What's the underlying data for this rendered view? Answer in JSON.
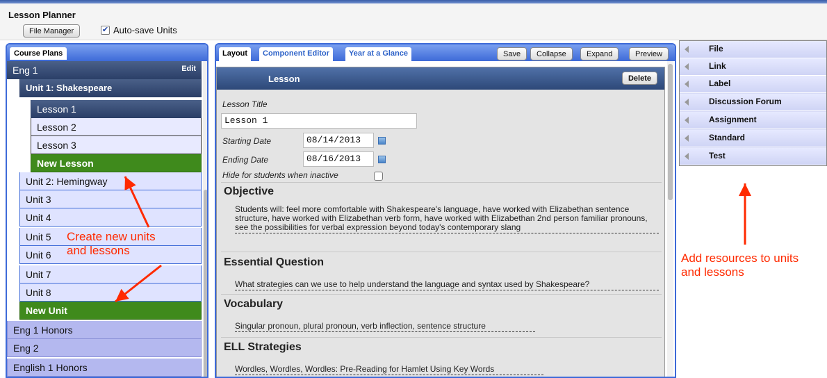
{
  "app": {
    "title": "Lesson Planner"
  },
  "toolbar": {
    "file_manager": "File Manager",
    "autosave_label": "Auto-save Units",
    "autosave_checked": true
  },
  "left_panel": {
    "tab": "Course Plans",
    "course": "Eng 1",
    "edit_label": "Edit",
    "unit1": "Unit 1: Shakespeare",
    "lessons": [
      "Lesson 1",
      "Lesson 2",
      "Lesson 3"
    ],
    "new_lesson": "New Lesson",
    "units": [
      "Unit 2: Hemingway",
      "Unit 3",
      "Unit 4",
      "Unit 5",
      "Unit 6",
      "Unit 7",
      "Unit 8"
    ],
    "new_unit": "New Unit",
    "other_courses": [
      "Eng 1 Honors",
      "Eng 2",
      "English 1 Honors"
    ]
  },
  "annotations": {
    "left": "Create new units\nand lessons",
    "right": "Add resources to units\nand lessons"
  },
  "mid_panel": {
    "tabs": [
      "Layout",
      "Component Editor",
      "Year at a Glance"
    ],
    "buttons": [
      "Save",
      "Collapse",
      "Expand",
      "Preview"
    ],
    "lesson_header": "Lesson",
    "delete": "Delete",
    "lesson_title_label": "Lesson Title",
    "lesson_title_value": "Lesson 1",
    "start_label": "Starting Date",
    "start_value": "08/14/2013",
    "end_label": "Ending Date",
    "end_value": "08/16/2013",
    "hide_label": "Hide for students when inactive",
    "sections": [
      {
        "title": "Objective",
        "body": "Students will: feel more comfortable with Shakespeare's language, have worked with Elizabethan sentence structure, have worked with Elizabethan verb form, have worked with Elizabethan 2nd person familiar pronouns, see the possibilities for verbal expression beyond today's contemporary slang"
      },
      {
        "title": "Essential Question",
        "body": "What strategies can we use to help understand the language and syntax used by Shakespeare?"
      },
      {
        "title": "Vocabulary",
        "body": "Singular pronoun, plural pronoun, verb inflection, sentence structure"
      },
      {
        "title": "ELL Strategies",
        "body": "Wordles, Wordles, Wordles: Pre-Reading for Hamlet Using Key Words"
      }
    ]
  },
  "resources": [
    "File",
    "Link",
    "Label",
    "Discussion Forum",
    "Assignment",
    "Standard",
    "Test"
  ],
  "colors": {
    "accent": "#3d6ad8",
    "green": "#3f8a1c",
    "annotation": "#ff2a00"
  }
}
